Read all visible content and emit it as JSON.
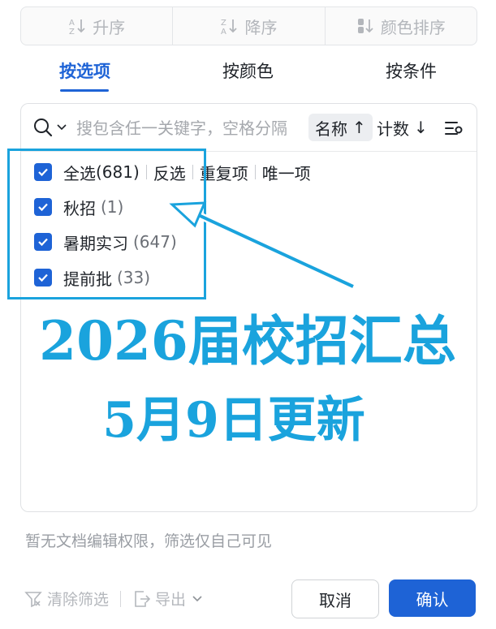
{
  "sort_bar": {
    "asc": "升序",
    "desc": "降序",
    "color_sort": "颜色排序"
  },
  "tabs": [
    {
      "label": "按选项",
      "active": true
    },
    {
      "label": "按颜色",
      "active": false
    },
    {
      "label": "按条件",
      "active": false
    }
  ],
  "search": {
    "placeholder": "搜包含任一关键字，空格分隔",
    "sort_name": "名称",
    "sort_name_arrow": "↑",
    "sort_count": "计数",
    "sort_count_arrow": "↓"
  },
  "select_all": {
    "label": "全选",
    "count": "(681)",
    "actions": [
      "反选",
      "重复项",
      "唯一项"
    ],
    "checked": true
  },
  "options": [
    {
      "label": "秋招",
      "count": "(1)",
      "checked": true
    },
    {
      "label": "暑期实习",
      "count": "(647)",
      "checked": true
    },
    {
      "label": "提前批",
      "count": "(33)",
      "checked": true
    }
  ],
  "overlay": {
    "title": "2026届校招汇总",
    "subtitle": "5月9日更新",
    "color": "#1aa3dd"
  },
  "note": "暂无文档编辑权限，筛选仅自己可见",
  "footer": {
    "clear": "清除筛选",
    "export": "导出",
    "cancel": "取消",
    "confirm": "确认"
  },
  "colors": {
    "accent": "#1e63d6",
    "annotation": "#1aa3dd"
  }
}
